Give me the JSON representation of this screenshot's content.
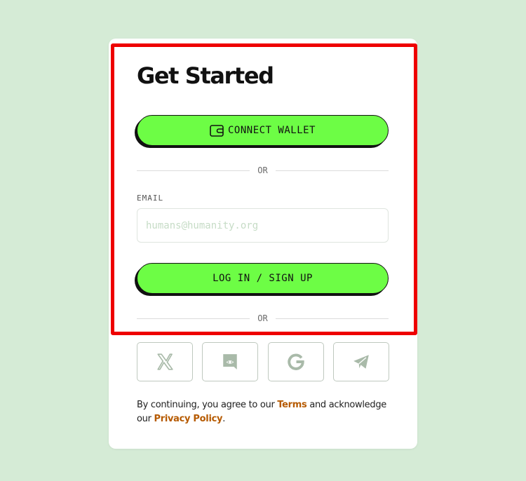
{
  "title": "Get Started",
  "wallet_button": {
    "label": "CONNECT WALLET",
    "icon": "wallet-icon"
  },
  "divider_text": "OR",
  "email": {
    "label": "EMAIL",
    "placeholder": "humans@humanity.org",
    "value": ""
  },
  "login_button": {
    "label": "LOG IN / SIGN UP"
  },
  "social_buttons": [
    {
      "icon": "x-twitter-icon"
    },
    {
      "icon": "discord-icon"
    },
    {
      "icon": "google-icon"
    },
    {
      "icon": "telegram-icon"
    }
  ],
  "footer": {
    "text_1": "By continuing, you agree to our ",
    "terms_link": "Terms",
    "text_2": " and acknowledge our ",
    "privacy_link": "Privacy Policy",
    "text_3": "."
  },
  "colors": {
    "background": "#d5ebd6",
    "button_green": "#6dfd45",
    "link": "#b65a00",
    "highlight": "#ee0000",
    "social_icon": "#a9baa9"
  }
}
